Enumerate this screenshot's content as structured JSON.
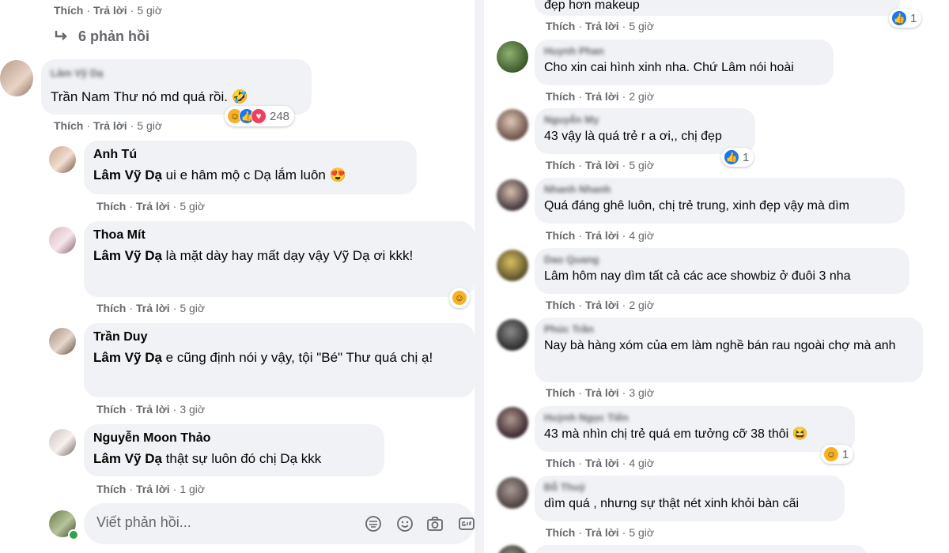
{
  "left": {
    "top_actions": {
      "like": "Thích",
      "reply": "Trả lời",
      "time": "5 giờ"
    },
    "replies_toggle": "6 phản hồi",
    "main_comment": {
      "author": "Lâm Vỹ Dạ",
      "text": "Trần Nam Thư nó md quá rồi. 🤣",
      "like": "Thích",
      "reply": "Trả lời",
      "time": "5 giờ",
      "reactions": {
        "count": "248"
      }
    },
    "replies": [
      {
        "author": "Anh Tú",
        "mention": "Lâm Vỹ Dạ",
        "text": " ui e hâm mộ c Dạ lắm luôn 😍",
        "like": "Thích",
        "reply": "Trả lời",
        "time": "5 giờ"
      },
      {
        "author": "Thoa Mít",
        "mention": "Lâm Vỹ Dạ",
        "text": " là mặt dày hay mất dạy vậy Vỹ Dạ ơi kkk!",
        "like": "Thích",
        "reply": "Trả lời",
        "time": "5 giờ"
      },
      {
        "author": "Trần Duy",
        "mention": "Lâm Vỹ Dạ",
        "text": " e cũng định nói y vậy, tội \"Bé\" Thư quá chị ạ!",
        "like": "Thích",
        "reply": "Trả lời",
        "time": "3 giờ"
      },
      {
        "author": "Nguyễn Moon Thảo",
        "mention": "Lâm Vỹ Dạ",
        "text": " thật sự luôn đó chị Dạ kkk",
        "like": "Thích",
        "reply": "Trả lời",
        "time": "1 giờ"
      }
    ],
    "composer": {
      "placeholder": "Viết phản hồi..."
    }
  },
  "right": {
    "comments": [
      {
        "author": "",
        "text": "đẹp hơn makeup",
        "like": "Thích",
        "reply": "Trả lời",
        "time": "5 giờ",
        "reaction_count": "1"
      },
      {
        "author": "Huynh Phan",
        "text": "Cho xin cai hình xinh nha. Chứ Lâm nói hoài",
        "like": "Thích",
        "reply": "Trả lời",
        "time": "2 giờ"
      },
      {
        "author": "Nguyễn My",
        "text": "43 vậy là quá trẻ r a ơi,, chị đẹp",
        "like": "Thích",
        "reply": "Trả lời",
        "time": "5 giờ",
        "reaction_count": "1"
      },
      {
        "author": "Nhanh Nhanh",
        "text": "Quá đáng ghê luôn, chị trẻ trung, xinh đẹp vậy mà dìm",
        "like": "Thích",
        "reply": "Trả lời",
        "time": "4 giờ"
      },
      {
        "author": "Dao Quang",
        "text": "Lâm hôm nay dìm tất cả các ace showbiz ở đuôi 3 nha",
        "like": "Thích",
        "reply": "Trả lời",
        "time": "2 giờ"
      },
      {
        "author": "Phúc Trần",
        "text": "Nay bà hàng xóm của em làm nghề bán rau ngoài chợ mà anh",
        "like": "Thích",
        "reply": "Trả lời",
        "time": "3 giờ"
      },
      {
        "author": "Huỳnh Ngọc Tiến",
        "text": "43 mà nhìn chị trẻ quá em tưởng cỡ 38 thôi 😆",
        "like": "Thích",
        "reply": "Trả lời",
        "time": "4 giờ",
        "reaction_count": "1"
      },
      {
        "author": "Đỗ Thuỷ",
        "text": "dìm quá , nhưng sự thật nét xinh khỏi bàn cãi",
        "like": "Thích",
        "reply": "Trả lời",
        "time": "5 giờ"
      }
    ]
  },
  "colors": {
    "bubble": "#f0f2f5",
    "meta": "#65676b",
    "like_blue": "#1877f2",
    "love_red": "#f33e58",
    "haha_yellow": "#f7b125"
  }
}
